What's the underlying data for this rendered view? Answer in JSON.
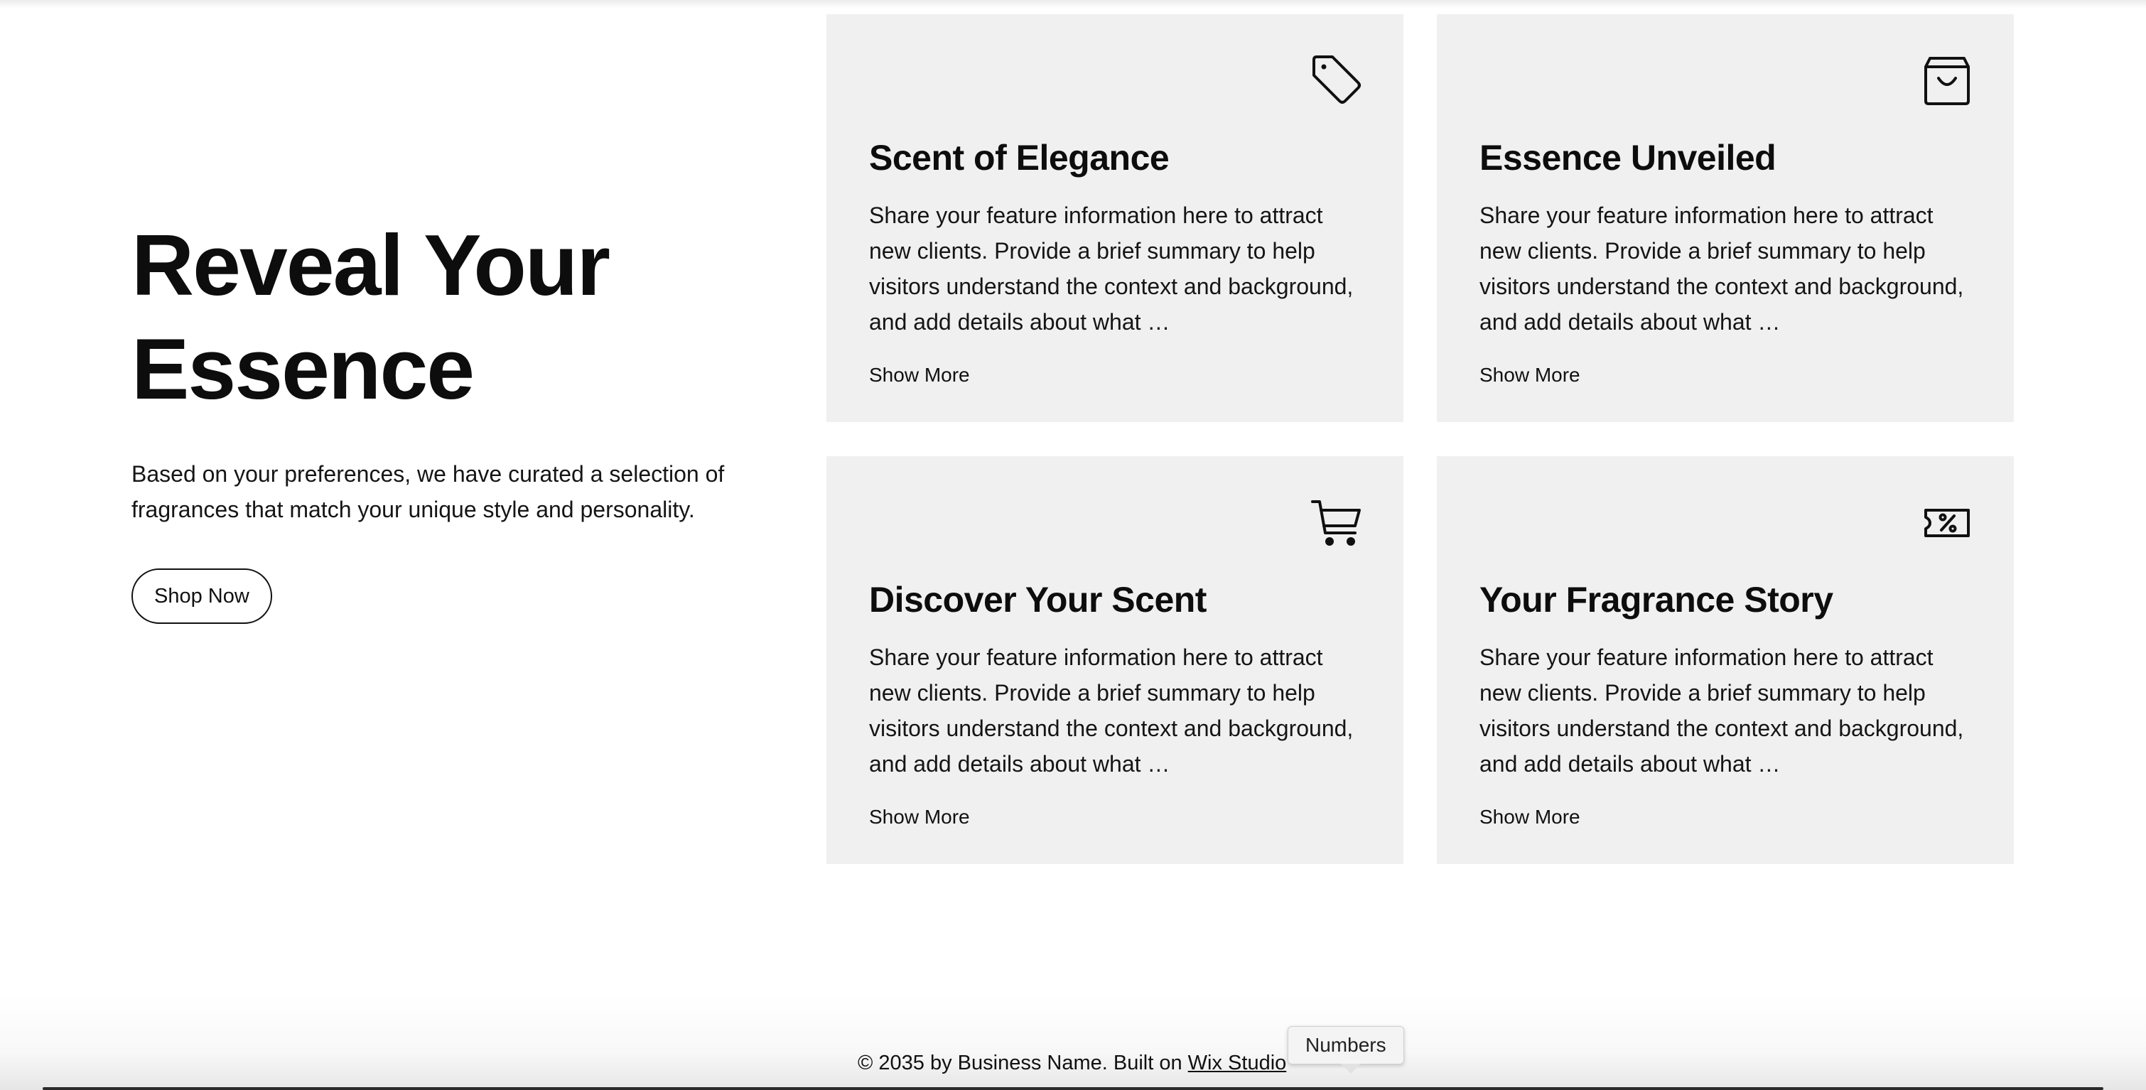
{
  "hero": {
    "title_line1": "Reveal Your",
    "title_line2": "Essence",
    "description": "Based on your preferences, we have curated a selection of fragrances that match your unique style and personality.",
    "button_label": "Shop Now"
  },
  "cards": [
    {
      "icon": "price-tag-icon",
      "title": "Scent of Elegance",
      "text": "Share your feature information here to attract new clients. Provide a brief summary to help visitors understand the context and background, and add details about what …",
      "more_label": "Show More"
    },
    {
      "icon": "shopping-bag-icon",
      "title": "Essence Unveiled",
      "text": "Share your feature information here to attract new clients. Provide a brief summary to help visitors understand the context and background, and add details about what …",
      "more_label": "Show More"
    },
    {
      "icon": "shopping-cart-icon",
      "title": "Discover Your Scent",
      "text": "Share your feature information here to attract new clients. Provide a brief summary to help visitors understand the context and background, and add details about what …",
      "more_label": "Show More"
    },
    {
      "icon": "discount-ticket-icon",
      "title": "Your Fragrance Story",
      "text": "Share your feature information here to attract new clients. Provide a brief summary to help visitors understand the context and background, and add details about what …",
      "more_label": "Show More"
    }
  ],
  "footer": {
    "copyright": "© 2035 by Business Name. Built on ",
    "link_label": "Wix Studio"
  },
  "tooltip": {
    "label": "Numbers"
  },
  "colors": {
    "card_background": "#f0f0f0",
    "text": "#111111",
    "page_background": "#ffffff"
  }
}
